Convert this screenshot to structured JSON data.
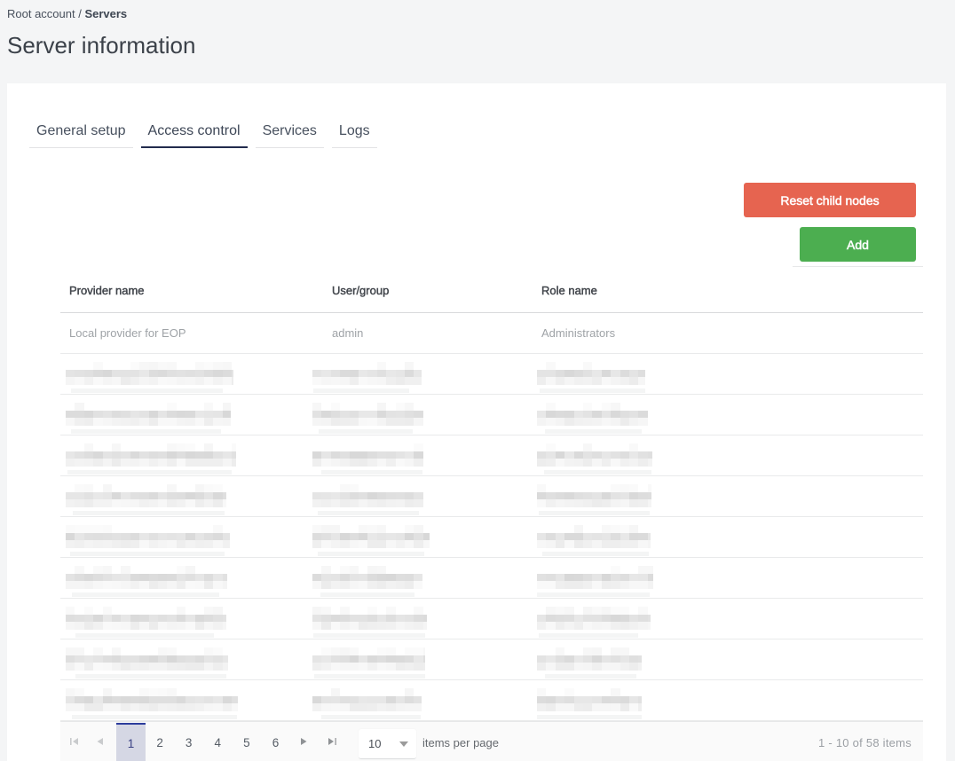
{
  "breadcrumb": {
    "root": "Root account",
    "separator": " / ",
    "current": "Servers"
  },
  "page_title": "Server information",
  "tabs": [
    {
      "label": "General setup",
      "active": false
    },
    {
      "label": "Access control",
      "active": true
    },
    {
      "label": "Services",
      "active": false
    },
    {
      "label": "Logs",
      "active": false
    }
  ],
  "toolbar": {
    "reset_label": "Reset child nodes",
    "add_label": "Add",
    "reset_color": "#e66450",
    "add_color": "#4cae50"
  },
  "table": {
    "columns": [
      "Provider name",
      "User/group",
      "Role name"
    ],
    "rows": [
      {
        "redacted": false,
        "cells": [
          "Local provider for EOP",
          "admin",
          "Administrators"
        ]
      },
      {
        "redacted": true
      },
      {
        "redacted": true
      },
      {
        "redacted": true
      },
      {
        "redacted": true
      },
      {
        "redacted": true
      },
      {
        "redacted": true
      },
      {
        "redacted": true
      },
      {
        "redacted": true
      },
      {
        "redacted": true
      }
    ]
  },
  "pager": {
    "pages": [
      "1",
      "2",
      "3",
      "4",
      "5",
      "6"
    ],
    "selected_page": "1",
    "page_size": "10",
    "items_per_page_label": "items per page",
    "info": "1 - 10 of 58 items",
    "selected_bg": "#d5d7e4",
    "selected_border": "#2c3c9c"
  }
}
